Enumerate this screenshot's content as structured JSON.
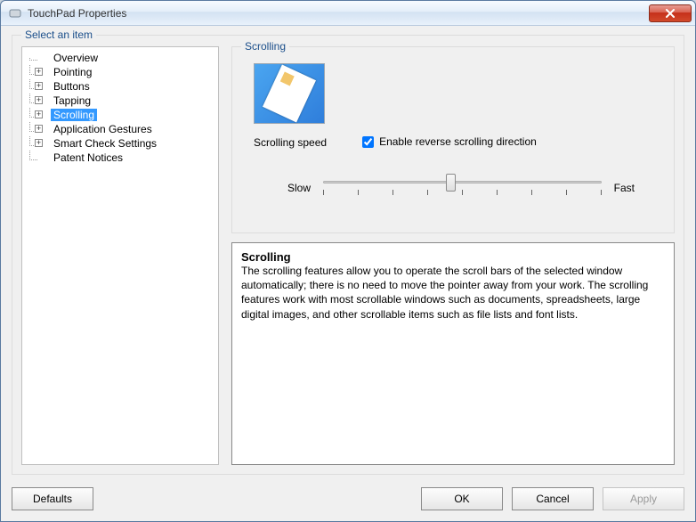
{
  "window": {
    "title": "TouchPad Properties"
  },
  "group": {
    "legend": "Select an item"
  },
  "tree": {
    "items": [
      {
        "label": "Overview",
        "expandable": false
      },
      {
        "label": "Pointing",
        "expandable": true
      },
      {
        "label": "Buttons",
        "expandable": true
      },
      {
        "label": "Tapping",
        "expandable": true
      },
      {
        "label": "Scrolling",
        "expandable": true,
        "selected": true
      },
      {
        "label": "Application Gestures",
        "expandable": true
      },
      {
        "label": "Smart Check Settings",
        "expandable": true
      },
      {
        "label": "Patent Notices",
        "expandable": false
      }
    ]
  },
  "scrolling": {
    "legend": "Scrolling",
    "speed_label": "Scrolling speed",
    "checkbox_label": "Enable reverse scrolling direction",
    "checkbox_checked": true,
    "slow_label": "Slow",
    "fast_label": "Fast"
  },
  "description": {
    "heading": "Scrolling",
    "body": "The scrolling features allow you to operate the scroll bars of the selected window automatically; there is no need to move the pointer away from your work. The scrolling features work with most scrollable windows such as documents, spreadsheets, large digital images, and other scrollable items such as file lists and font lists."
  },
  "buttons": {
    "defaults": "Defaults",
    "ok": "OK",
    "cancel": "Cancel",
    "apply": "Apply"
  }
}
